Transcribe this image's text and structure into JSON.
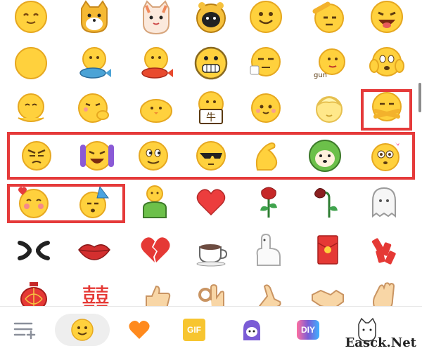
{
  "emoji_grid": {
    "rows": [
      [
        "slight-smile",
        "shiba-dog",
        "cat",
        "tiger-ball",
        "smile",
        "salute",
        "laughing-tongue"
      ],
      [
        "yellow-ball",
        "hold-fish",
        "hold-red-fish",
        "grin-teeth",
        "smirk-cup",
        "gun-hand",
        "panic-hands"
      ],
      [
        "hands-chin",
        "thinking",
        "chick",
        "hold-sign",
        "innocent",
        "blonde-hair",
        "arms-crossed"
      ],
      [
        "frown",
        "laugh-tears",
        "side-eye",
        "sunglasses",
        "flex-arm",
        "frog-doge",
        "starry-eyes"
      ],
      [
        "blush-heart",
        "party-hat",
        "green-man",
        "red-heart",
        "rose",
        "wilted-rose",
        "ghost"
      ],
      [
        "anger-symbol",
        "lips",
        "broken-heart",
        "coffee",
        "alpaca",
        "red-envelope",
        "firecracker"
      ],
      [
        "lantern",
        "double-happiness",
        "thumbs-up",
        "ok-hand",
        "pinky",
        "handshake",
        "waving-hand"
      ]
    ],
    "highlighted": [
      "arms-crossed",
      "row-4",
      "blush-heart",
      "party-hat"
    ]
  },
  "sign_text": "牛",
  "gun_text": "gun",
  "double_happiness": "囍",
  "gif_label": "GIF",
  "diy_label": "DIY",
  "bottom_bar": {
    "tabs": [
      {
        "name": "manage-icon",
        "active": false
      },
      {
        "name": "smiley-icon",
        "active": true
      },
      {
        "name": "heart-icon",
        "active": false
      },
      {
        "name": "gif-icon",
        "active": false
      },
      {
        "name": "ghost-avatar-icon",
        "active": false
      },
      {
        "name": "diy-icon",
        "active": false
      },
      {
        "name": "cat-sticker-icon",
        "active": false
      }
    ]
  },
  "watermark": "Easck.Net",
  "colors": {
    "highlight": "#e53a3a",
    "emoji_yellow": "#ffd13d",
    "emoji_stroke": "#e0a020"
  }
}
